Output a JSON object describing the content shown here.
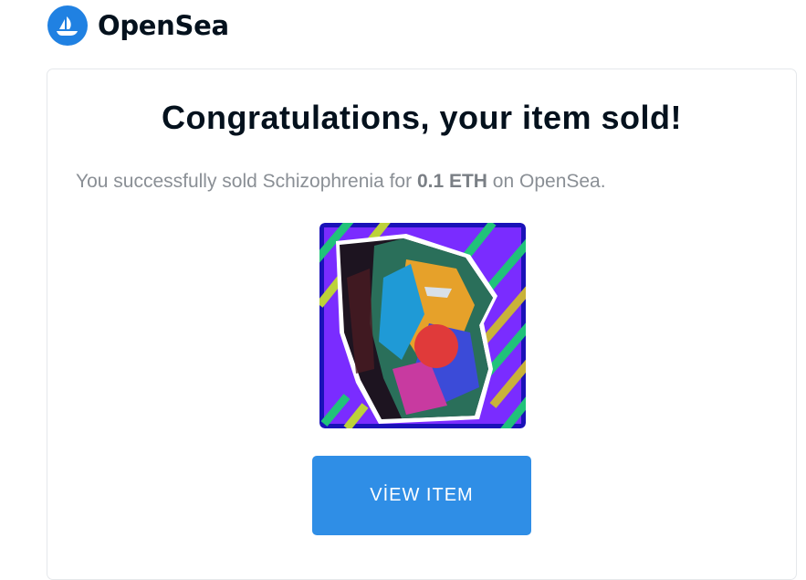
{
  "header": {
    "brand_name": "OpenSea",
    "logo_icon": "opensea-ship-icon",
    "brand_color": "#2081e2"
  },
  "email": {
    "headline": "Congratulations, your item sold!",
    "message_prefix": "You successfully sold Schizophrenia for ",
    "price": "0.1 ETH",
    "message_suffix": " on OpenSea.",
    "item_image": "nft-artwork-image",
    "button_label": "VİEW ITEM",
    "button_color": "#2f8ee6"
  }
}
